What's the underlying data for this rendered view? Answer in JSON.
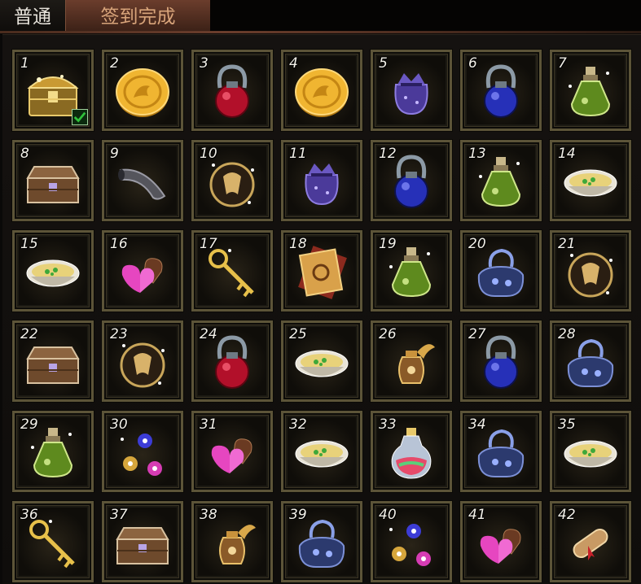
{
  "tabs": [
    {
      "label": "普通",
      "active": false
    },
    {
      "label": "签到完成",
      "active": true
    }
  ],
  "slots": [
    {
      "num": "1",
      "icon": "treasure-chest-gold-icon",
      "checked": true
    },
    {
      "num": "2",
      "icon": "gold-coin-icon"
    },
    {
      "num": "3",
      "icon": "red-potion-icon"
    },
    {
      "num": "4",
      "icon": "gold-coin-icon"
    },
    {
      "num": "5",
      "icon": "purple-pouch-icon"
    },
    {
      "num": "6",
      "icon": "blue-potion-icon"
    },
    {
      "num": "7",
      "icon": "green-elixir-icon"
    },
    {
      "num": "8",
      "icon": "wooden-chest-icon"
    },
    {
      "num": "9",
      "icon": "horn-icon"
    },
    {
      "num": "10",
      "icon": "gold-medallion-icon"
    },
    {
      "num": "11",
      "icon": "purple-pouch-icon"
    },
    {
      "num": "12",
      "icon": "blue-potion-icon"
    },
    {
      "num": "13",
      "icon": "green-elixir-icon"
    },
    {
      "num": "14",
      "icon": "soup-bowl-icon"
    },
    {
      "num": "15",
      "icon": "soup-bowl-icon"
    },
    {
      "num": "16",
      "icon": "candy-hearts-icon"
    },
    {
      "num": "17",
      "icon": "golden-key-icon"
    },
    {
      "num": "18",
      "icon": "scroll-book-icon"
    },
    {
      "num": "19",
      "icon": "green-elixir-icon"
    },
    {
      "num": "20",
      "icon": "blue-sack-icon"
    },
    {
      "num": "21",
      "icon": "gold-medallion-icon"
    },
    {
      "num": "22",
      "icon": "wooden-chest-icon"
    },
    {
      "num": "23",
      "icon": "gold-medallion-icon"
    },
    {
      "num": "24",
      "icon": "red-potion-icon"
    },
    {
      "num": "25",
      "icon": "soup-bowl-icon"
    },
    {
      "num": "26",
      "icon": "dragon-vase-icon"
    },
    {
      "num": "27",
      "icon": "blue-potion-icon"
    },
    {
      "num": "28",
      "icon": "blue-sack-icon"
    },
    {
      "num": "29",
      "icon": "green-elixir-icon"
    },
    {
      "num": "30",
      "icon": "gem-orbs-icon"
    },
    {
      "num": "31",
      "icon": "candy-hearts-icon"
    },
    {
      "num": "32",
      "icon": "soup-bowl-icon"
    },
    {
      "num": "33",
      "icon": "rainbow-potion-icon"
    },
    {
      "num": "34",
      "icon": "blue-sack-icon"
    },
    {
      "num": "35",
      "icon": "soup-bowl-icon"
    },
    {
      "num": "36",
      "icon": "golden-key-icon"
    },
    {
      "num": "37",
      "icon": "wooden-chest-icon"
    },
    {
      "num": "38",
      "icon": "dragon-vase-icon"
    },
    {
      "num": "39",
      "icon": "blue-sack-icon"
    },
    {
      "num": "40",
      "icon": "gem-orbs-icon"
    },
    {
      "num": "41",
      "icon": "candy-hearts-icon"
    },
    {
      "num": "42",
      "icon": "scroll-icon"
    }
  ],
  "colors": {
    "accent_tab": "#6b3d2c",
    "accent_tab_text": "#d8a47a",
    "slot_border": "#5c5438",
    "check_green": "#2fc23a"
  }
}
